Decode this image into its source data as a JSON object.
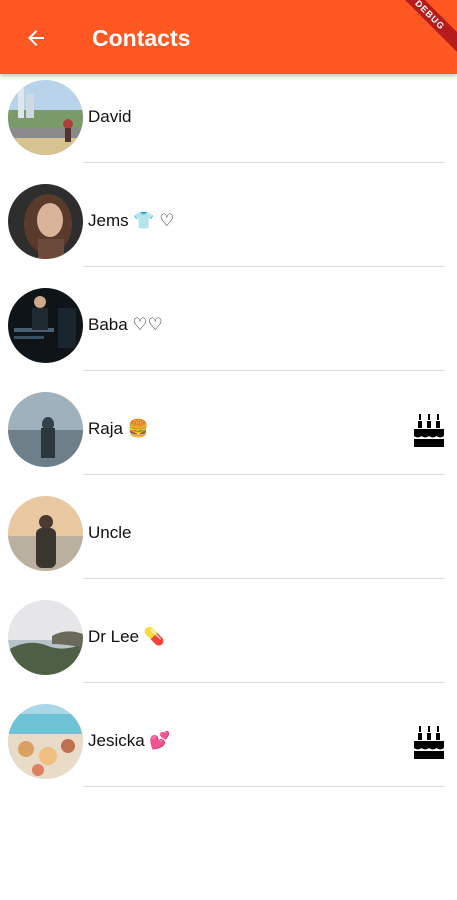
{
  "app_bar": {
    "title": "Contacts",
    "back_icon": "arrow-back-icon",
    "color": "#ff5722",
    "debug_banner": "DEBUG"
  },
  "contacts": [
    {
      "name": "David",
      "birthday_icon": false
    },
    {
      "name": "Jems 👕 ♡",
      "birthday_icon": false
    },
    {
      "name": "Baba ♡♡",
      "birthday_icon": false
    },
    {
      "name": "Raja 🍔",
      "birthday_icon": true
    },
    {
      "name": "Uncle",
      "birthday_icon": false
    },
    {
      "name": "Dr Lee 💊",
      "birthday_icon": false
    },
    {
      "name": "Jesicka 💕",
      "birthday_icon": true
    }
  ],
  "icons": {
    "birthday": "cake-icon"
  }
}
